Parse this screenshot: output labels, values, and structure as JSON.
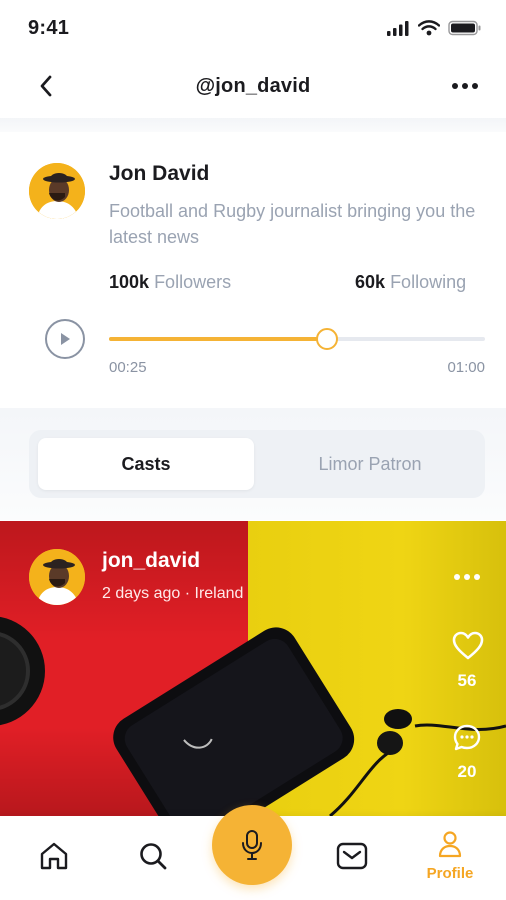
{
  "status_bar": {
    "time": "9:41"
  },
  "header": {
    "title": "@jon_david"
  },
  "profile": {
    "name": "Jon David",
    "bio": "Football and Rugby journalist bringing you the latest news",
    "followers_count": "100k",
    "followers_label": "Followers",
    "following_count": "60k",
    "following_label": "Following"
  },
  "audio": {
    "elapsed": "00:25",
    "duration": "01:00",
    "progress": 0.58
  },
  "tabs": [
    {
      "label": "Casts",
      "active": true
    },
    {
      "label": "Limor Patron",
      "active": false
    }
  ],
  "post": {
    "username": "jon_david",
    "meta": "2 days ago · Ireland",
    "likes": "56",
    "comments": "20"
  },
  "bottom_nav": {
    "items": [
      "home-icon",
      "search-icon",
      "mic-icon",
      "inbox-icon",
      "profile-icon"
    ],
    "profile_label": "Profile"
  },
  "colors": {
    "accent": "#f5b335",
    "muted": "#9aa3b2",
    "post_red": "#e11f26",
    "post_yellow": "#eed414"
  }
}
